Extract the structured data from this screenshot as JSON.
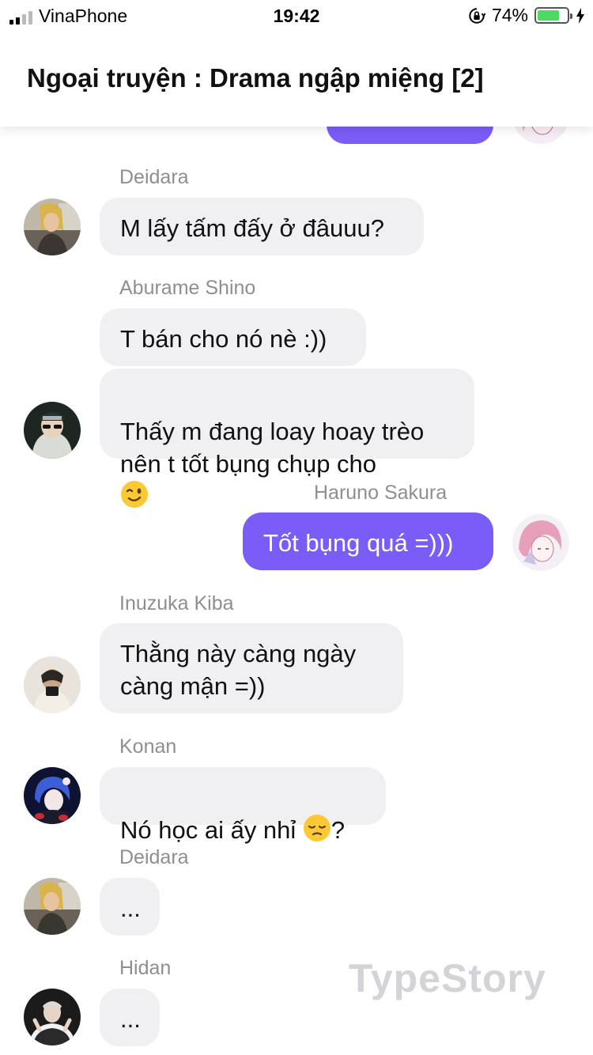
{
  "status_bar": {
    "carrier": "VinaPhone",
    "time": "19:42",
    "battery_percent": "74%",
    "battery_level": 0.74,
    "signal_bars_on": 2,
    "battery_color": "#4cd964"
  },
  "header": {
    "title": "Ngoại truyện : Drama ngập miệng [2]"
  },
  "colors": {
    "outgoing_bubble": "#7a5cf7",
    "incoming_bubble": "#f0f0f3",
    "sender_name": "#8e8e93"
  },
  "messages": [
    {
      "sender": "Deidara",
      "text": "M lấy tấm đấy ở đâuuu?"
    },
    {
      "sender": "Aburame Shino",
      "text": "T bán cho nó nè :))"
    },
    {
      "sender": "Aburame Shino",
      "text": "Thấy m đang loay hoay trèo\nnên t tốt bụng chụp cho",
      "emoji": "winking-face-emoji"
    },
    {
      "sender": "Haruno Sakura",
      "text": "Tốt bụng quá =)))"
    },
    {
      "sender": "Inuzuka Kiba",
      "text": "Thằng này càng ngày\ncàng mận =))"
    },
    {
      "sender": "Konan",
      "text_before": "Nó học ai ấy nhỉ ",
      "emoji": "pensive-face-emoji",
      "text_after": "?"
    },
    {
      "sender": "Deidara",
      "text": "..."
    },
    {
      "sender": "Hidan",
      "text": "..."
    }
  ],
  "watermark": "TypeStory"
}
